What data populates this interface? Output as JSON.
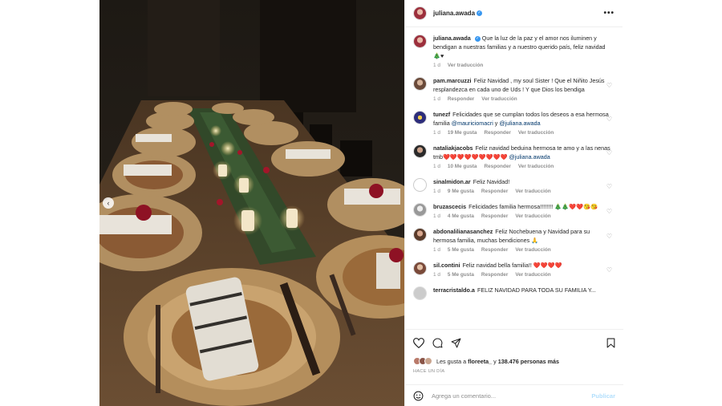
{
  "post": {
    "username": "juliana.awada",
    "more_icon": "more-horizontal-icon",
    "caption": "Que la luz de la paz y el amor nos iluminen y bendigan a nuestras familias y a nuestro querido país, feliz navidad 🎄♥",
    "caption_age": "1 d",
    "caption_translate": "Ver traducción"
  },
  "comments": [
    {
      "user": "pam.marcuzzi",
      "text": "Feliz Navidad , my soul Sister ! Que el Niñito Jesús resplandezca en cada uno de Uds ! Y que Dios los bendiga",
      "age": "1 d",
      "likes": "",
      "reply": "Responder",
      "translate": "Ver traducción"
    },
    {
      "user": "tunezf",
      "text": "Felicidades que se cumplan todos los deseos a esa hermosa familia ",
      "mention1": "@mauriciomacri",
      "mid": " y ",
      "mention2": "@juliana.awada",
      "age": "1 d",
      "likes": "19 Me gusta",
      "reply": "Responder",
      "translate": "Ver traducción"
    },
    {
      "user": "nataliakjacobs",
      "text": "Feliz navidad beduina hermosa te amo y a las nenas tmb❤️❤️❤️❤️❤️❤️❤️❤️❤️ ",
      "mention1": "@juliana.awada",
      "age": "1 d",
      "likes": "10 Me gusta",
      "reply": "Responder",
      "translate": "Ver traducción"
    },
    {
      "user": "sinalmidon.ar",
      "text": "Feliz Navidad!",
      "age": "1 d",
      "likes": "9 Me gusta",
      "reply": "Responder",
      "translate": "Ver traducción"
    },
    {
      "user": "bruzascecis",
      "text": "Felicidades familia hermosa!!!!!!!! 🎄🎄❤️❤️😘😘",
      "age": "1 d",
      "likes": "4 Me gusta",
      "reply": "Responder",
      "translate": "Ver traducción"
    },
    {
      "user": "abdonalilianasanchez",
      "text": "Feliz Nochebuena y Navidad para su hermosa familia, muchas bendiciones 🙏",
      "age": "1 d",
      "likes": "5 Me gusta",
      "reply": "Responder",
      "translate": "Ver traducción"
    },
    {
      "user": "sil.contini",
      "text": "Feliz navidad bella familia!! ❤️❤️❤️❤️",
      "age": "1 d",
      "likes": "5 Me gusta",
      "reply": "Responder",
      "translate": "Ver traducción"
    },
    {
      "user": "terracristaldo.a",
      "text": "FELIZ NAVIDAD PARA TODA SU FAMILIA Y...",
      "age": "",
      "likes": "",
      "reply": "",
      "translate": ""
    }
  ],
  "actions": {
    "like_icon": "heart-icon",
    "comment_icon": "comment-icon",
    "share_icon": "share-icon",
    "save_icon": "bookmark-icon",
    "likes_prefix": "Les gusta a ",
    "likes_user": "floreeta_",
    "likes_mid": " y ",
    "likes_count": "138.476 personas más",
    "time_ago": "HACE UN DÍA"
  },
  "add_comment": {
    "emoji_icon": "emoji-icon",
    "placeholder": "Agrega un comentario...",
    "post_label": "Publicar"
  },
  "colors": {
    "link": "#00376b",
    "verified": "#3897f0",
    "post_disabled": "#b2dffc",
    "muted": "#8e8e8e"
  }
}
